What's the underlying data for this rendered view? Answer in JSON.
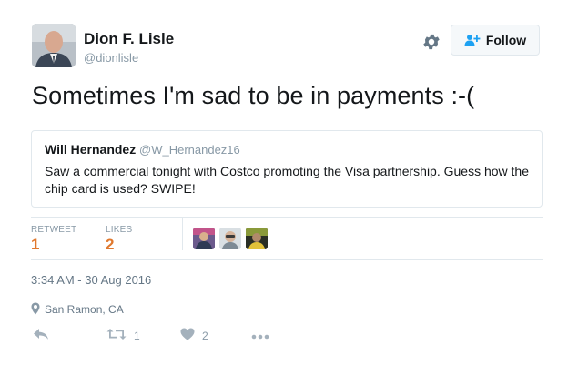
{
  "author": {
    "name": "Dion F. Lisle",
    "handle": "@dionlisle"
  },
  "follow_label": "Follow",
  "tweet_text": "Sometimes I'm sad to be in payments :-(",
  "quoted": {
    "name": "Will Hernandez",
    "handle": "@W_Hernandez16",
    "text": "Saw a commercial tonight with Costco promoting the Visa partnership. Guess how the chip card is used? SWIPE!"
  },
  "stats": {
    "retweet_label": "RETWEET",
    "retweet_count": "1",
    "likes_label": "LIKES",
    "likes_count": "2"
  },
  "timestamp": "3:34 AM - 30 Aug 2016",
  "location": "San Ramon, CA",
  "actions": {
    "retweet_count": "1",
    "like_count": "2"
  },
  "icons": [
    "gear-icon",
    "follow-person-icon",
    "location-pin-icon",
    "reply-icon",
    "retweet-icon",
    "heart-icon",
    "more-icon"
  ],
  "colors": {
    "stat_value": "#e0782d",
    "muted": "#8899a6",
    "border": "#e1e8ed"
  }
}
